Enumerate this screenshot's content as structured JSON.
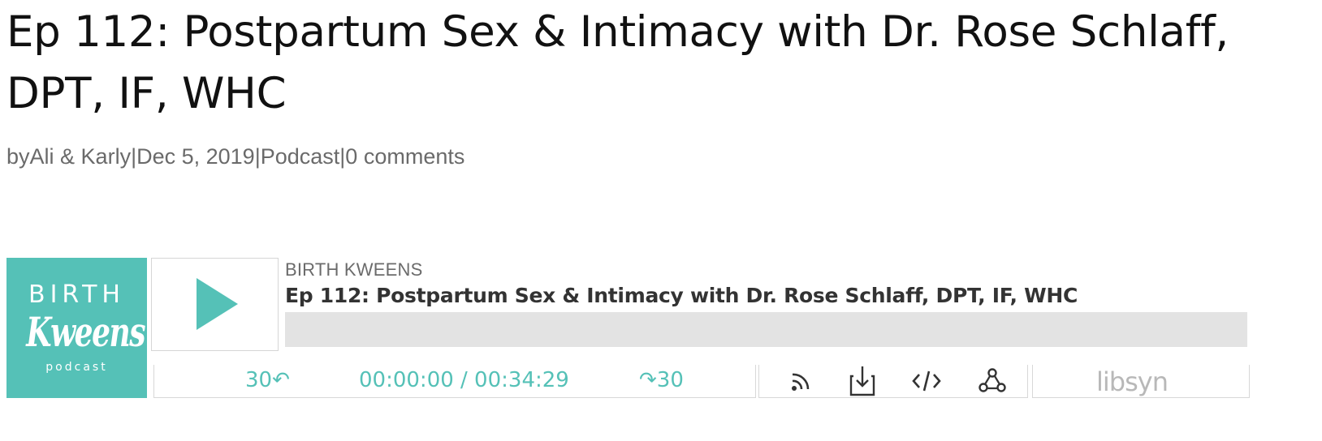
{
  "post": {
    "title": "Ep 112: Postpartum Sex & Intimacy with Dr. Rose Schlaff, DPT, IF, WHC",
    "meta": {
      "by_prefix": "by ",
      "author": "Ali & Karly",
      "sep1": " | ",
      "date": "Dec 5, 2019",
      "sep2": " | ",
      "category": "Podcast",
      "sep3": " | ",
      "comments": "0 comments"
    }
  },
  "player": {
    "artwork": {
      "line1": "BIRTH",
      "line2": "Kweens",
      "line3": "podcast"
    },
    "show_name": "BIRTH KWEENS",
    "episode_title": "Ep 112: Postpartum Sex & Intimacy with Dr. Rose Schlaff, DPT, IF, WHC",
    "progress_fraction": 0,
    "skip_back": "30↶",
    "time": "00:00:00 / 00:34:29",
    "skip_forward": "↷30",
    "brand": "libsyn",
    "colors": {
      "accent": "#55c1b7",
      "bar": "#e3e3e3"
    },
    "icons": [
      "play-icon",
      "rss-icon",
      "download-icon",
      "embed-code-icon",
      "share-icon",
      "libsyn-logo"
    ]
  }
}
